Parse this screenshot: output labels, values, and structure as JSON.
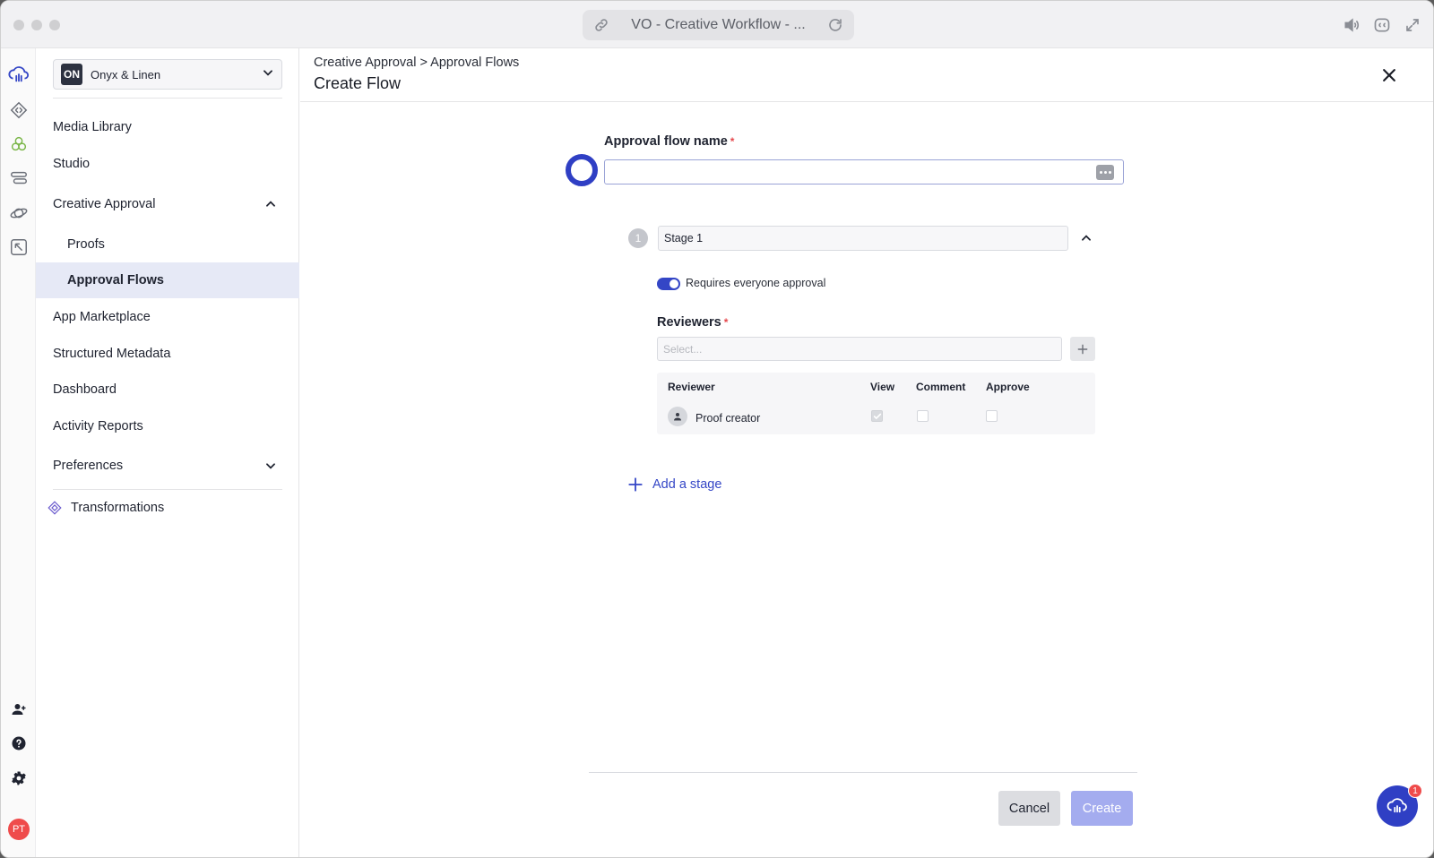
{
  "window": {
    "title": "VO - Creative Workflow - ..."
  },
  "org": {
    "badge": "ON",
    "name": "Onyx & Linen"
  },
  "sidebar": {
    "items": [
      {
        "label": "Media Library"
      },
      {
        "label": "Studio"
      },
      {
        "label": "Creative Approval",
        "expanded": true
      },
      {
        "label": "Proofs"
      },
      {
        "label": "Approval Flows",
        "active": true
      },
      {
        "label": "App Marketplace"
      },
      {
        "label": "Structured Metadata"
      },
      {
        "label": "Dashboard"
      },
      {
        "label": "Activity Reports"
      },
      {
        "label": "Preferences",
        "expanded": false
      }
    ],
    "transformations": "Transformations"
  },
  "rail": {
    "avatar_initials": "PT",
    "icons": [
      "cloud-logo-icon",
      "code-diamond-icon",
      "triple-circle-icon",
      "stack-list-icon",
      "planet-icon",
      "arrow-pointer-icon",
      "add-user-icon",
      "help-icon",
      "settings-icon"
    ]
  },
  "header": {
    "breadcrumb": "Creative Approval > Approval Flows",
    "title": "Create Flow"
  },
  "form": {
    "name_label": "Approval flow name",
    "required_mark": "*",
    "name_value": "",
    "stage": {
      "number": "1",
      "name": "Stage 1",
      "toggle_label": "Requires everyone approval",
      "toggle_on": true,
      "reviewers_label": "Reviewers",
      "reviewers_placeholder": "Select...",
      "table": {
        "headers": [
          "Reviewer",
          "View",
          "Comment",
          "Approve"
        ],
        "rows": [
          {
            "name": "Proof creator",
            "view": true,
            "comment": false,
            "approve": false
          }
        ]
      }
    },
    "add_stage_label": "Add a stage"
  },
  "footer": {
    "cancel_label": "Cancel",
    "create_label": "Create"
  },
  "chat": {
    "badge": "1"
  },
  "colors": {
    "accent": "#3446c6",
    "create_disabled": "#a4acef",
    "required": "#e5484d",
    "active_nav_bg": "#e6e9f6"
  }
}
